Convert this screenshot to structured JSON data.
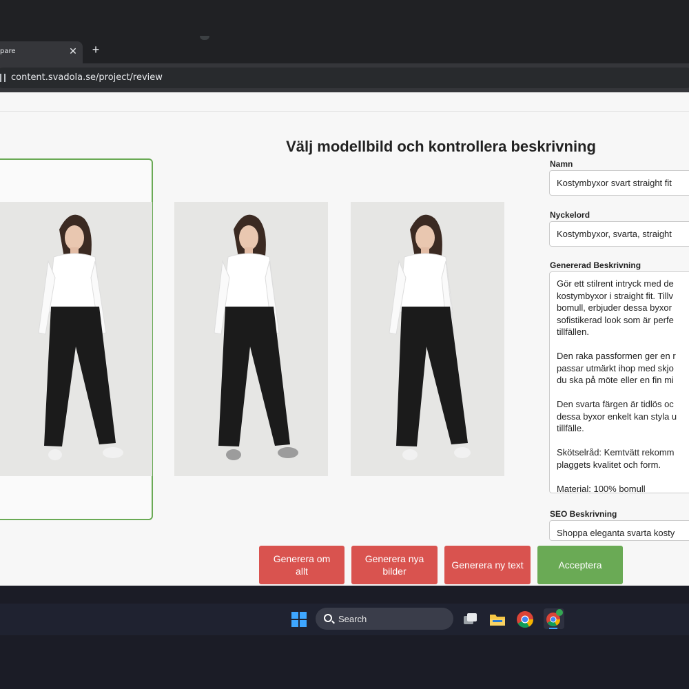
{
  "browser": {
    "tab_title": "pare",
    "tab_close": "✕",
    "new_tab": "+",
    "url": "content.svadola.se/project/review"
  },
  "page": {
    "heading": "Välj modellbild och kontrollera beskrivning"
  },
  "form": {
    "name_label": "Namn",
    "name_value": "Kostymbyxor svart straight fit",
    "keywords_label": "Nyckelord",
    "keywords_value": "Kostymbyxor, svarta, straight",
    "description_label": "Genererad Beskrivning",
    "description_value": "Gör ett stilrent intryck med de\nkostymbyxor i straight fit. Tillv\nbomull, erbjuder dessa byxor\nsofistikerad look som är perfe\ntillfällen.\n\nDen raka passformen ger en r\npassar utmärkt ihop med skjo\ndu ska på möte eller en fin mi\n\nDen svarta färgen är tidlös oc\ndessa byxor enkelt kan styla u\ntillfälle.\n\nSkötselråd: Kemtvätt rekomm\nplaggets kvalitet och form.\n\nMaterial: 100% bomull",
    "seo_label": "SEO Beskrivning",
    "seo_value": "Shoppa eleganta svarta kosty"
  },
  "buttons": {
    "regenerate_all": "Generera om allt",
    "new_images": "Generera nya bilder",
    "new_text": "Generera ny text",
    "accept": "Acceptera"
  },
  "taskbar": {
    "search_label": "Search"
  },
  "colors": {
    "accent_green": "#6aaa55",
    "button_red": "#d9534f"
  }
}
